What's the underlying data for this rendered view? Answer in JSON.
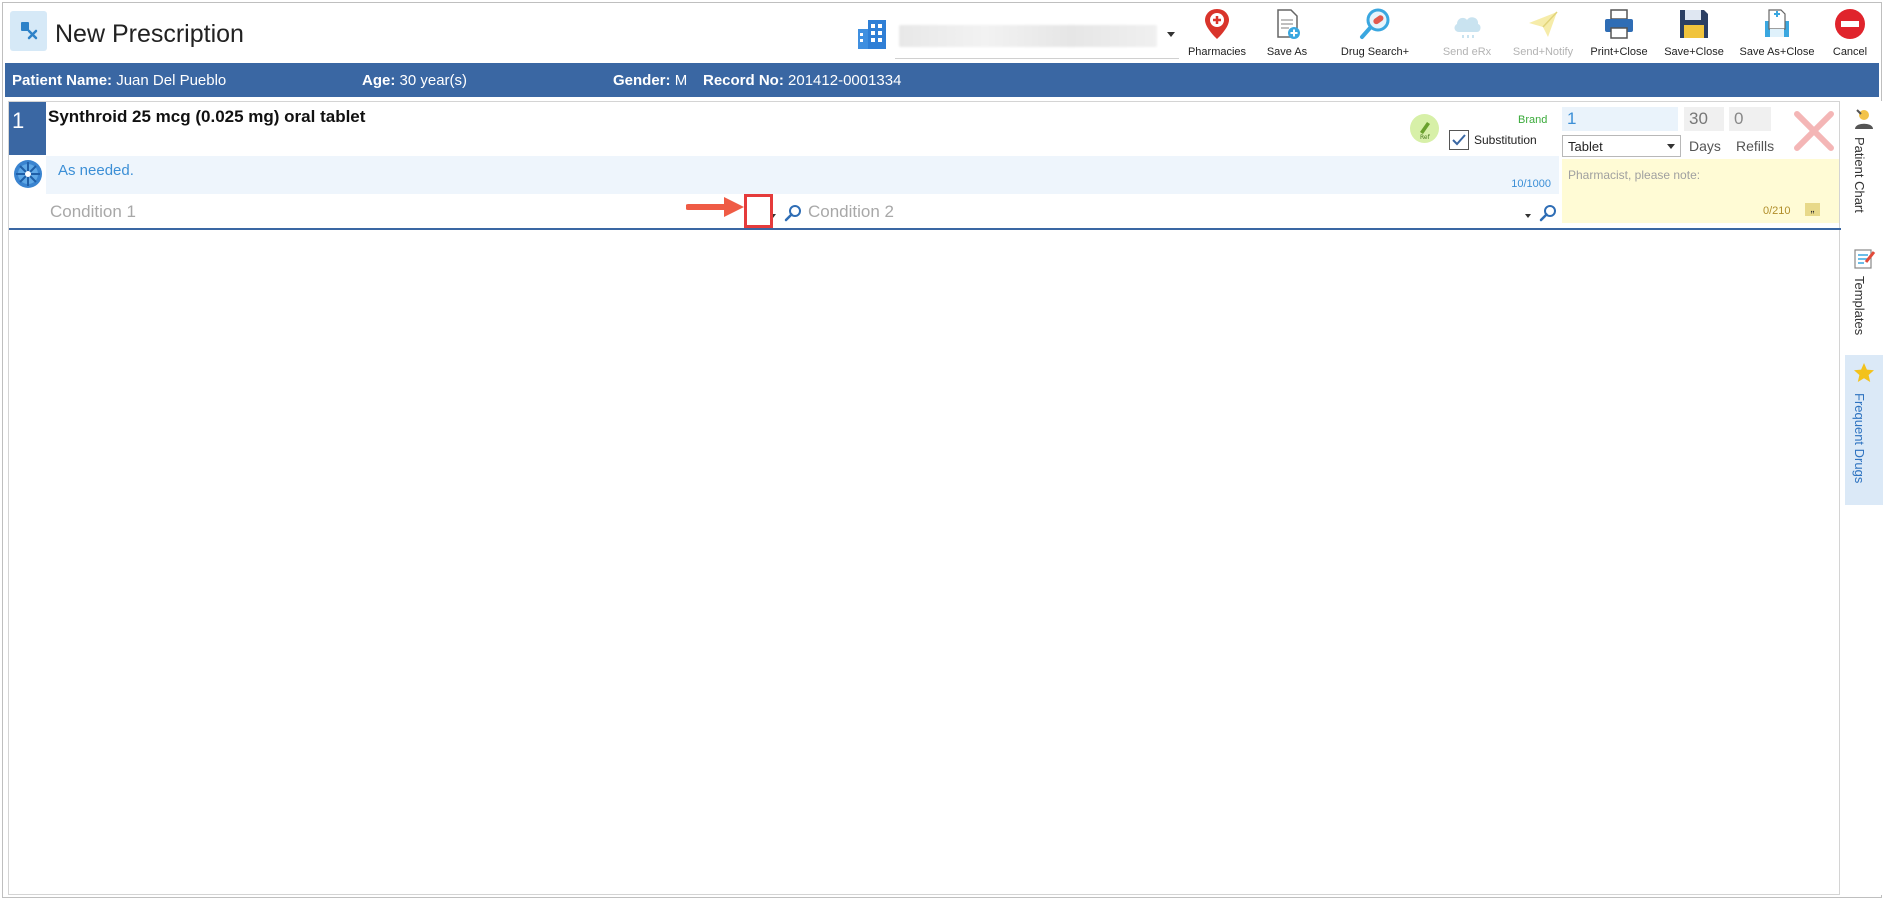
{
  "window": {
    "title": "New Prescription",
    "location_select": {
      "value": ""
    }
  },
  "toolbar": {
    "items": [
      {
        "label": "Pharmacies",
        "icon": "map-pin-icon",
        "enabled": true
      },
      {
        "label": "Save As",
        "icon": "document-plus-icon",
        "enabled": true
      },
      {
        "label": "Drug Search+",
        "icon": "magnifier-pill-icon",
        "enabled": true
      },
      {
        "label": "Send eRx",
        "icon": "cloud-icon",
        "enabled": false
      },
      {
        "label": "Send+Notify",
        "icon": "paper-plane-icon",
        "enabled": false
      },
      {
        "label": "Print+Close",
        "icon": "printer-icon",
        "enabled": true
      },
      {
        "label": "Save+Close",
        "icon": "floppy-disk-icon",
        "enabled": true
      },
      {
        "label": "Save As+Close",
        "icon": "document-save-icon",
        "enabled": true
      },
      {
        "label": "Cancel",
        "icon": "no-entry-icon",
        "enabled": true
      }
    ]
  },
  "patient": {
    "name_label": "Patient Name:",
    "name_value": "Juan Del Pueblo",
    "age_label": "Age:",
    "age_value": "30 year(s)",
    "gender_label": "Gender:",
    "gender_value": "M",
    "record_label": "Record No:",
    "record_value": "201412-0001334"
  },
  "prescription": {
    "number": "1",
    "drug_name": "Synthroid 25 mcg (0.025 mg) oral tablet",
    "sig_text": "As needed.",
    "sig_count": "10/1000",
    "brand_label": "Brand",
    "substitution_label": "Substitution",
    "substitution_checked": true,
    "quantity": "1",
    "unit": "Tablet",
    "days_value": "30",
    "days_label": "Days",
    "refills_value": "0",
    "refills_label": "Refills",
    "pharmacist_note_placeholder": "Pharmacist, please note:",
    "note_count": "0/210",
    "note_quote": "„",
    "condition1_placeholder": "Condition 1",
    "condition2_placeholder": "Condition 2"
  },
  "side_rail": {
    "items": [
      {
        "label": "Patient Chart",
        "icon": "patient-chart-icon",
        "active": false
      },
      {
        "label": "Templates",
        "icon": "templates-icon",
        "active": false
      },
      {
        "label": "Frequent Drugs",
        "icon": "star-icon",
        "active": true
      }
    ]
  },
  "colors": {
    "accent": "#3a67a3",
    "link_blue": "#3c8fd6",
    "brand_green": "#3aaa3a",
    "note_bg": "#fffbd5",
    "highlight_red": "#e53b3b"
  }
}
